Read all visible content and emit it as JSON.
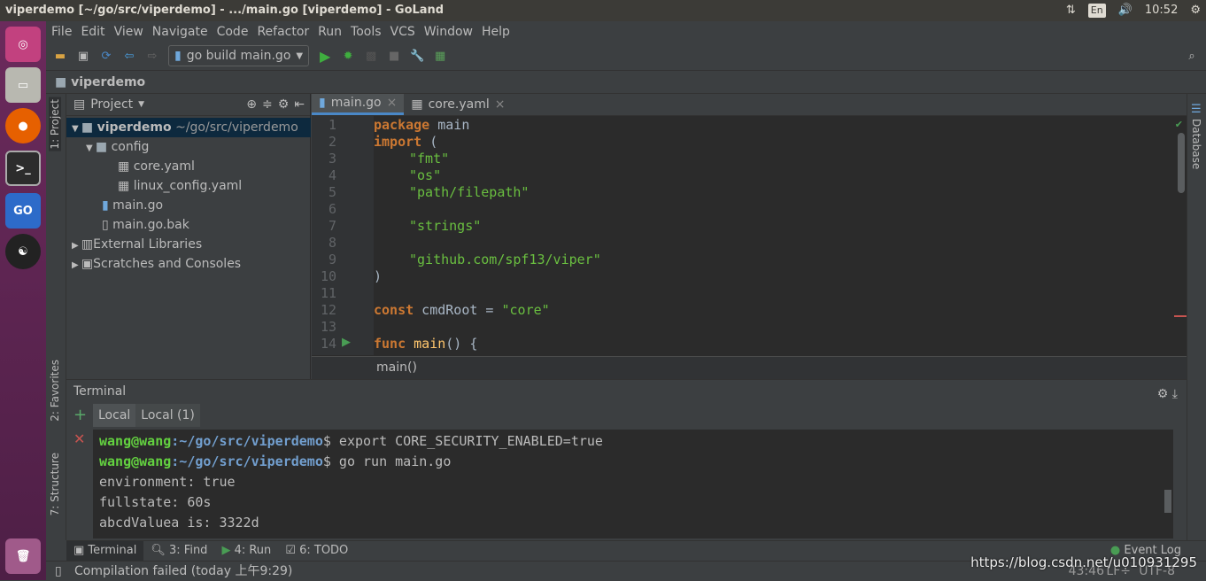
{
  "window": {
    "title": "viperdemo [~/go/src/viperdemo] - .../main.go [viperdemo] - GoLand"
  },
  "tray": {
    "lang": "En",
    "time": "10:52"
  },
  "menu": [
    "File",
    "Edit",
    "View",
    "Navigate",
    "Code",
    "Refactor",
    "Run",
    "Tools",
    "VCS",
    "Window",
    "Help"
  ],
  "toolbar": {
    "run_config": "go build main.go"
  },
  "navbar": {
    "project": "viperdemo"
  },
  "left_stripe": {
    "project": "1: Project",
    "favorites": "2: Favorites",
    "structure": "7: Structure"
  },
  "right_stripe": {
    "database": "Database"
  },
  "project_panel": {
    "title": "Project",
    "tree": [
      {
        "label": "viperdemo",
        "extra": "~/go/src/viperdemo",
        "selected": true
      },
      {
        "label": "config"
      },
      {
        "label": "core.yaml"
      },
      {
        "label": "linux_config.yaml"
      },
      {
        "label": "main.go"
      },
      {
        "label": "main.go.bak"
      },
      {
        "label": "External Libraries"
      },
      {
        "label": "Scratches and Consoles"
      }
    ]
  },
  "editor": {
    "tabs": [
      "main.go",
      "core.yaml"
    ],
    "active_tab": "main.go",
    "line_numbers": [
      "1",
      "2",
      "3",
      "4",
      "5",
      "6",
      "7",
      "8",
      "9",
      "10",
      "11",
      "12",
      "13",
      "14"
    ],
    "lines": {
      "l1k": "package",
      "l1": " main",
      "l2k": "import",
      "l2": " (",
      "l3": "\"fmt\"",
      "l4": "\"os\"",
      "l5": "\"path/filepath\"",
      "l7": "\"strings\"",
      "l9": "\"github.com/spf13/viper\"",
      "l10": ")",
      "l12k": "const",
      "l12": " cmdRoot = ",
      "l12s": "\"core\"",
      "l14k": "func",
      "l14f": "main",
      "l14": "() {"
    },
    "breadcrumb": "main()"
  },
  "terminal": {
    "title": "Terminal",
    "tabs": [
      "Local",
      "Local (1)"
    ],
    "active_tab": "Local",
    "lines": [
      {
        "user": "wang@wang",
        "path": ":~/go/src/viperdemo",
        "cmd": "$ export CORE_SECURITY_ENABLED=true"
      },
      {
        "user": "wang@wang",
        "path": ":~/go/src/viperdemo",
        "cmd": "$ go run main.go"
      },
      {
        "text": "environment: true"
      },
      {
        "text": "fullstate: 60s"
      },
      {
        "text": "abcdValuea is: 3322d"
      }
    ]
  },
  "bottom_tabs": [
    "Terminal",
    "3: Find",
    "4: Run",
    "6: TODO"
  ],
  "event_log": "Event Log",
  "status": {
    "message": "Compilation failed (today 上午9:29)",
    "position": "43:46",
    "line_sep": "LF÷",
    "encoding": "UTF-8"
  },
  "watermark": "https://blog.csdn.net/u010931295"
}
